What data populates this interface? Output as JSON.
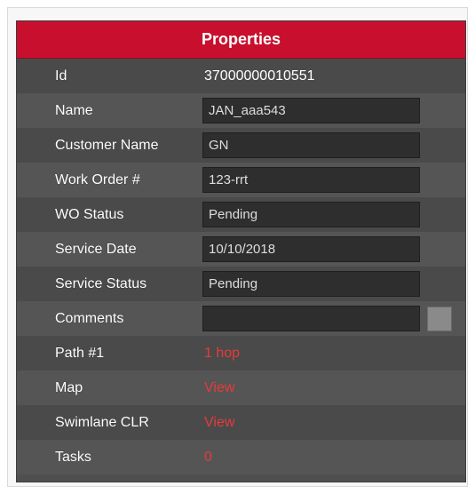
{
  "panel": {
    "title": "Properties",
    "accent_color": "#c8102e",
    "link_color": "#e83a3a"
  },
  "fields": {
    "id": {
      "label": "Id",
      "value": "37000000010551"
    },
    "name": {
      "label": "Name",
      "value": "JAN_aaa543"
    },
    "customer_name": {
      "label": "Customer Name",
      "value": "GN"
    },
    "work_order": {
      "label": "Work Order #",
      "value": "123-rrt"
    },
    "wo_status": {
      "label": "WO Status",
      "value": "Pending"
    },
    "service_date": {
      "label": "Service Date",
      "value": "10/10/2018"
    },
    "service_status": {
      "label": "Service Status",
      "value": "Pending"
    },
    "comments": {
      "label": "Comments",
      "value": ""
    },
    "path1": {
      "label": "Path #1",
      "value": "1 hop"
    },
    "map": {
      "label": "Map",
      "value": "View"
    },
    "swimlane_clr": {
      "label": "Swimlane CLR",
      "value": "View"
    },
    "tasks": {
      "label": "Tasks",
      "value": "0"
    }
  }
}
